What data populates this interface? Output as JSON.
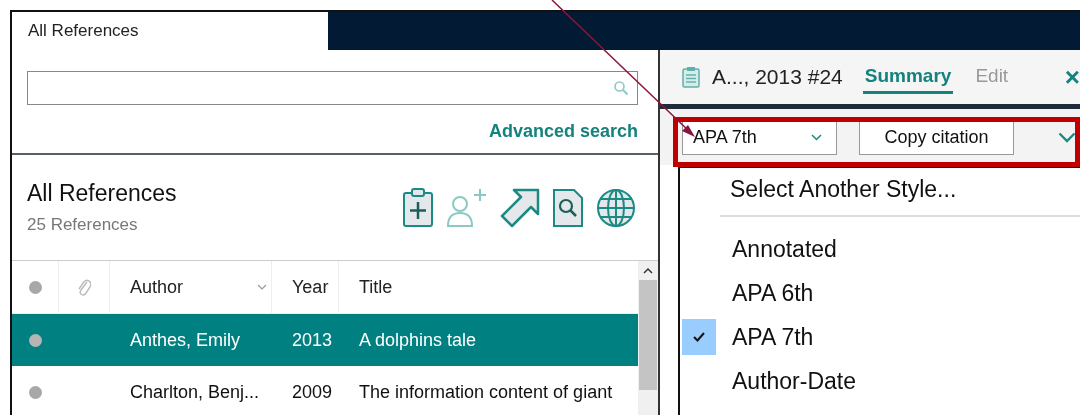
{
  "tabs": [
    {
      "label": "All References",
      "selected": true
    }
  ],
  "advanced_search": "Advanced search",
  "library": {
    "title": "All References",
    "count": "25 References"
  },
  "table": {
    "columns": [
      "Author",
      "Year",
      "Title"
    ],
    "rows": [
      {
        "author": "Anthes, Emily",
        "year": "2013",
        "title": "A dolphins tale",
        "selected": true
      },
      {
        "author": "Charlton, Benj...",
        "year": "2009",
        "title": "The information content of giant",
        "selected": false
      }
    ]
  },
  "reference_panel": {
    "title": "A..., 2013 #24",
    "tabs": [
      {
        "label": "Summary",
        "selected": true
      },
      {
        "label": "Edit",
        "selected": false
      }
    ],
    "close": "×"
  },
  "citation_toolbar": {
    "style": "APA 7th",
    "copy_button": "Copy citation"
  },
  "style_menu": {
    "header": "Select Another Style...",
    "items": [
      {
        "label": "Annotated",
        "checked": false
      },
      {
        "label": "APA 6th",
        "checked": false
      },
      {
        "label": "APA 7th",
        "checked": true
      },
      {
        "label": "Author-Date",
        "checked": false
      }
    ]
  }
}
